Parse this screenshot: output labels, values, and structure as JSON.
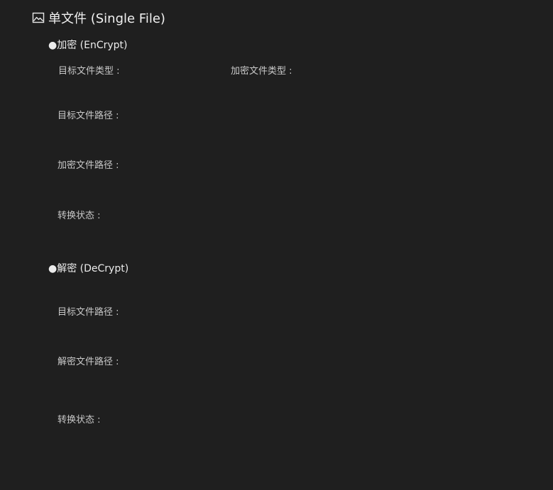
{
  "header": {
    "icon": "image-icon",
    "title": "单文件 (Single File)"
  },
  "encrypt": {
    "title": "●加密 (EnCrypt)",
    "target_type_label": "目标文件类型 :",
    "encrypted_type_label": "加密文件类型 :",
    "target_path_label": "目标文件路径 :",
    "encrypted_path_label": "加密文件路径 :",
    "status_label": "转换状态 :"
  },
  "decrypt": {
    "title": "●解密 (DeCrypt)",
    "target_path_label": "目标文件路径 :",
    "decrypted_path_label": "解密文件路径 :",
    "status_label": "转换状态 :"
  }
}
